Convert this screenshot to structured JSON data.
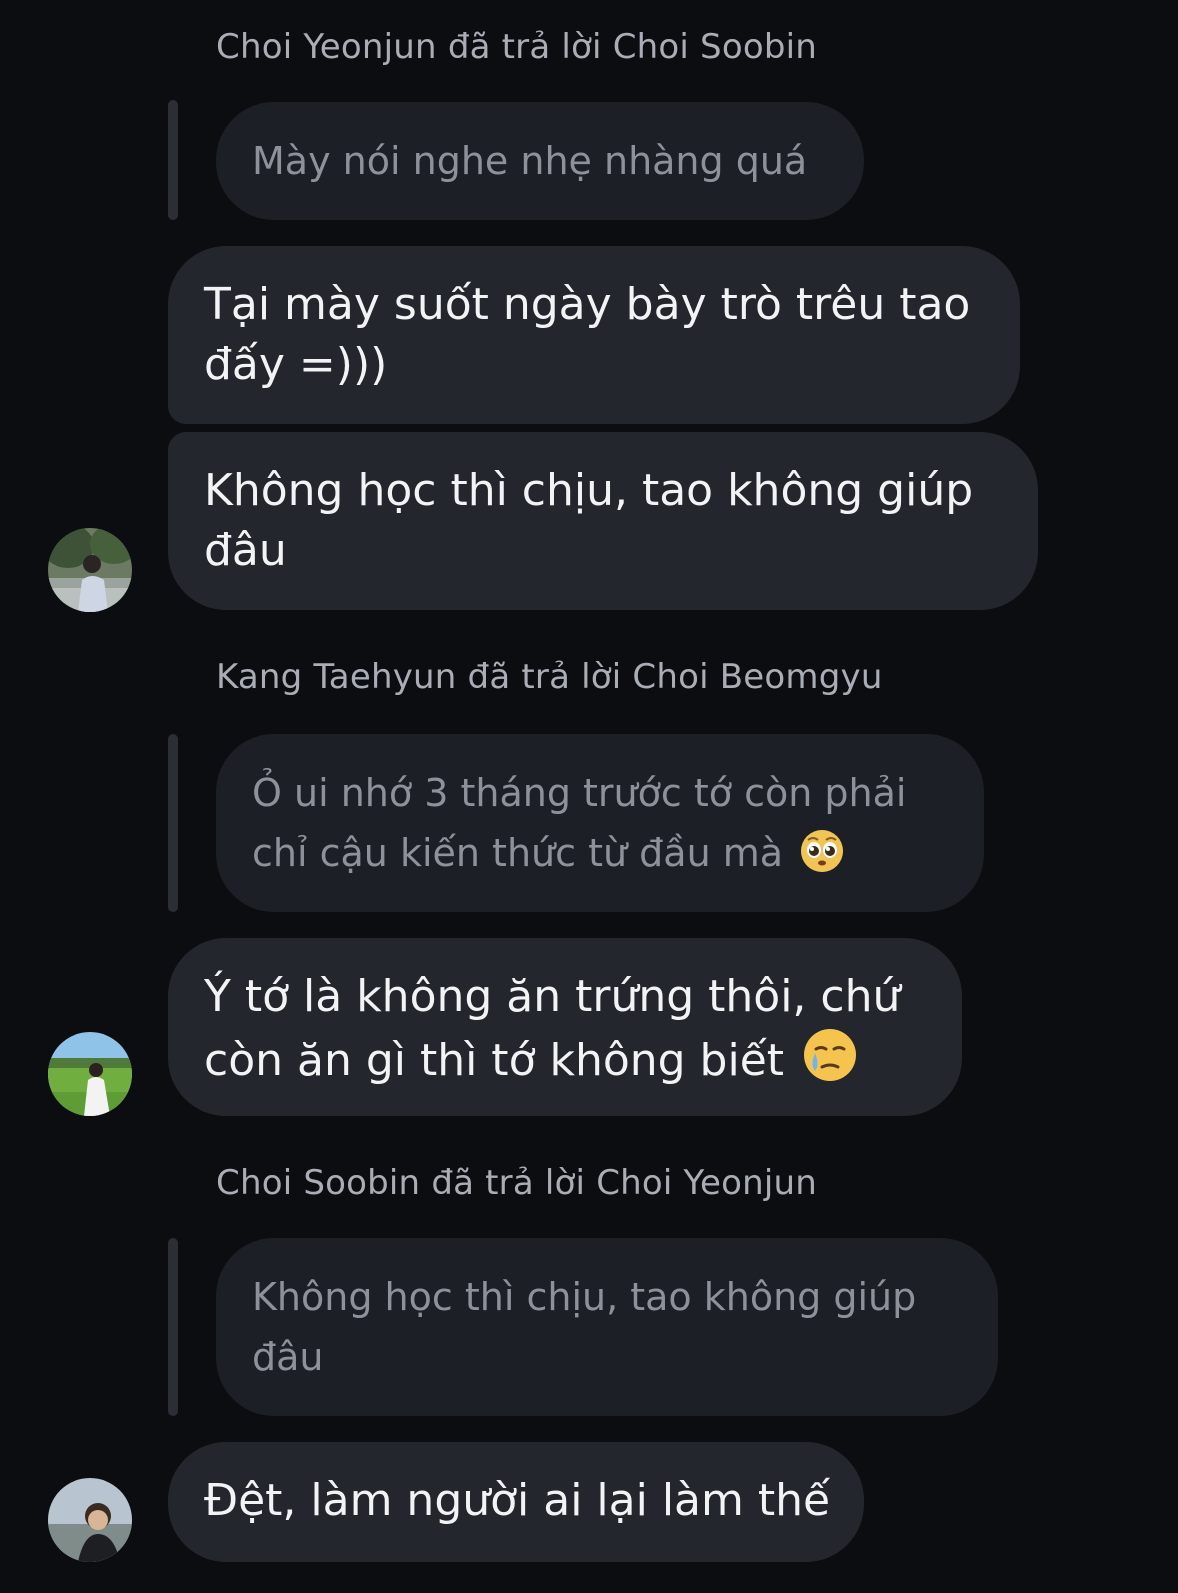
{
  "thread": {
    "reply1": {
      "header": "Choi Yeonjun đã trả lời Choi Soobin",
      "quoted": "Mày nói nghe nhẹ nhàng quá"
    },
    "msg1": {
      "line1": "Tại mày suốt ngày bày trò trêu tao",
      "line2": "đấy =)))"
    },
    "msg2": {
      "line1": "Không học thì chịu, tao không giúp",
      "line2": "đâu"
    },
    "reply2": {
      "header": "Kang Taehyun đã trả lời Choi Beomgyu",
      "quoted_line1": "Ỏ ui nhớ 3 tháng trước tớ còn phải",
      "quoted_line2": "chỉ cậu kiến thức từ đầu mà",
      "quoted_emoji": "pleading-face"
    },
    "msg3": {
      "line1": "Ý tớ là không ăn trứng thôi, chứ",
      "line2": "còn ăn gì thì tớ không biết",
      "emoji": "face-holding-back-tears"
    },
    "reply3": {
      "header": "Choi Soobin đã trả lời Choi Yeonjun",
      "quoted_line1": "Không học thì chịu, tao không giúp",
      "quoted_line2": "đâu"
    },
    "msg4": {
      "text": "Đệt, làm người ai lại làm thế"
    }
  },
  "theme": {
    "background": "#0b0d11",
    "bubble": "#23262c",
    "quoted_bubble": "#1c1f25",
    "text": "#f2f3f5",
    "muted_text": "#a9adb5",
    "reply_bar": "#2b2e35"
  }
}
